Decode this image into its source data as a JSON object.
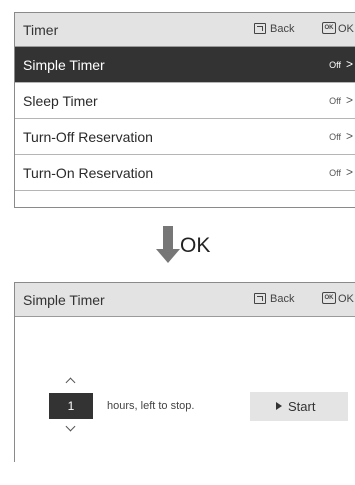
{
  "screen1": {
    "title": "Timer",
    "back_label": "Back",
    "ok_icon_text": "OK",
    "ok_label": "OK",
    "items": [
      {
        "label": "Simple Timer",
        "value": "Off",
        "selected": true
      },
      {
        "label": "Sleep Timer",
        "value": "Off",
        "selected": false
      },
      {
        "label": "Turn-Off Reservation",
        "value": "Off",
        "selected": false
      },
      {
        "label": "Turn-On Reservation",
        "value": "Off",
        "selected": false
      }
    ]
  },
  "transition": {
    "label": "OK",
    "icon": "down-arrow-icon"
  },
  "screen2": {
    "title": "Simple Timer",
    "back_label": "Back",
    "ok_icon_text": "OK",
    "ok_label": "OK",
    "hours_value": "1",
    "hours_text": "hours, left to stop.",
    "start_label": "Start"
  },
  "colors": {
    "header_bg": "#e3e3e3",
    "selected_bg": "#333333",
    "button_bg": "#e4e4e4",
    "arrow": "#777777"
  }
}
